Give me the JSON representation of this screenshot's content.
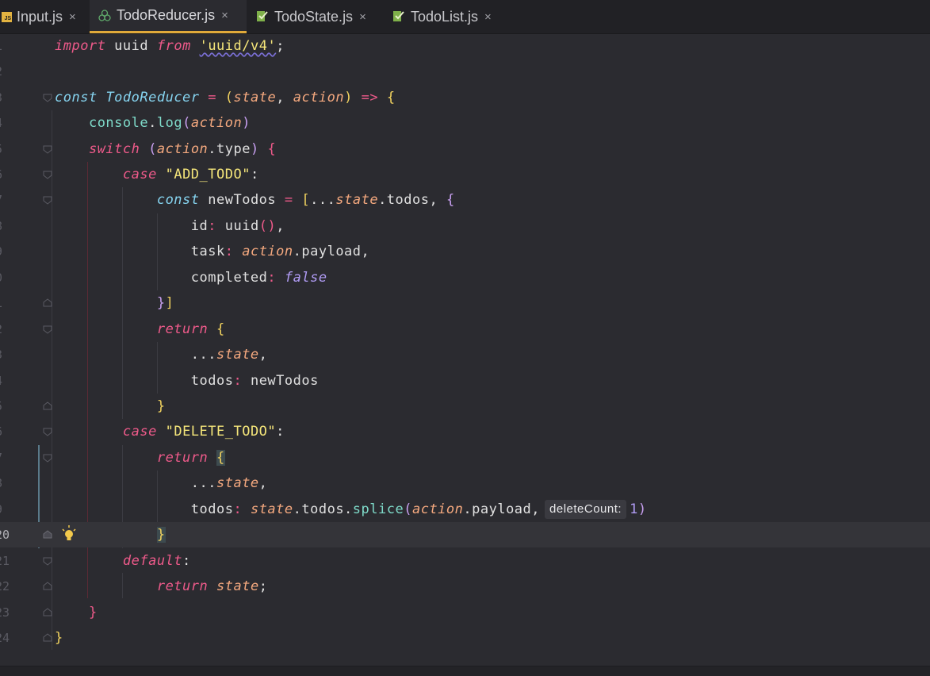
{
  "tabs": [
    {
      "label": "Input.js",
      "icon": "js-file-icon",
      "active": false
    },
    {
      "label": "TodoReducer.js",
      "icon": "react-file-icon",
      "active": true
    },
    {
      "label": "TodoState.js",
      "icon": "react-component-icon",
      "active": false
    },
    {
      "label": "TodoList.js",
      "icon": "react-component-icon",
      "active": false
    }
  ],
  "tab_close_symbol": "×",
  "line_numbers": [
    "1",
    "2",
    "3",
    "4",
    "5",
    "6",
    "7",
    "8",
    "9",
    "0",
    "1",
    "2",
    "3",
    "4",
    "5",
    "6",
    "7",
    "8",
    "9",
    "20",
    "21",
    "22",
    "23",
    "24"
  ],
  "inlay_hint": "deleteCount:",
  "colors": {
    "background": "#2b2b30",
    "tab_active_underline": "#e0a93a",
    "keyword": "#ee5a8a",
    "string": "#f5e67a",
    "parameter": "#f5a97f"
  }
}
